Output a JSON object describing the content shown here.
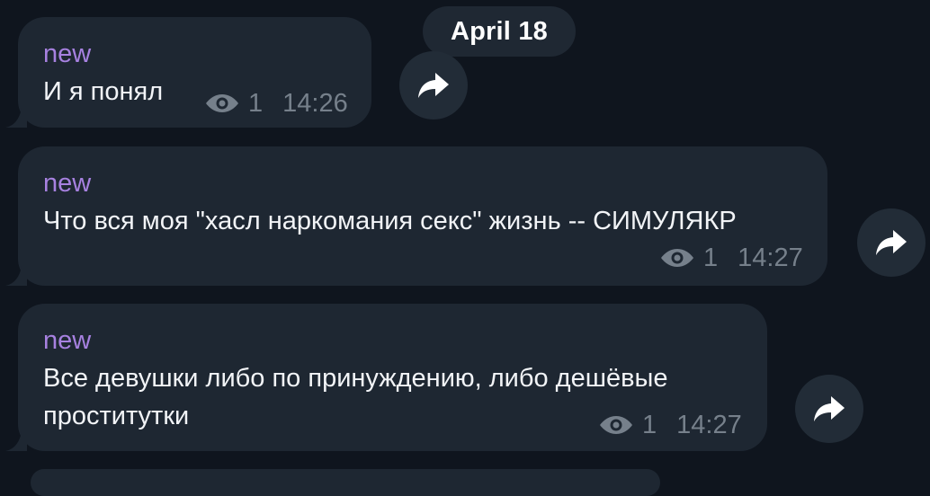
{
  "date_separator": "April 18",
  "messages": [
    {
      "sender": "new",
      "text_lines": [
        "И я понял"
      ],
      "views": "1",
      "time": "14:26"
    },
    {
      "sender": "new",
      "text_lines": [
        "Что вся моя \"хасл наркомания секс\" жизнь -- СИМУЛЯКР"
      ],
      "views": "1",
      "time": "14:27"
    },
    {
      "sender": "new",
      "text_lines": [
        "Все девушки либо по принуждению, либо дешёвые",
        "проститутки"
      ],
      "views": "1",
      "time": "14:27"
    }
  ],
  "icons": {
    "views": "eye-icon",
    "forward": "share-arrow-icon"
  },
  "colors": {
    "background": "#0f151e",
    "bubble": "#1e2732",
    "sender": "#a781e0",
    "meta": "#76808b",
    "text": "#f2f4f7"
  }
}
